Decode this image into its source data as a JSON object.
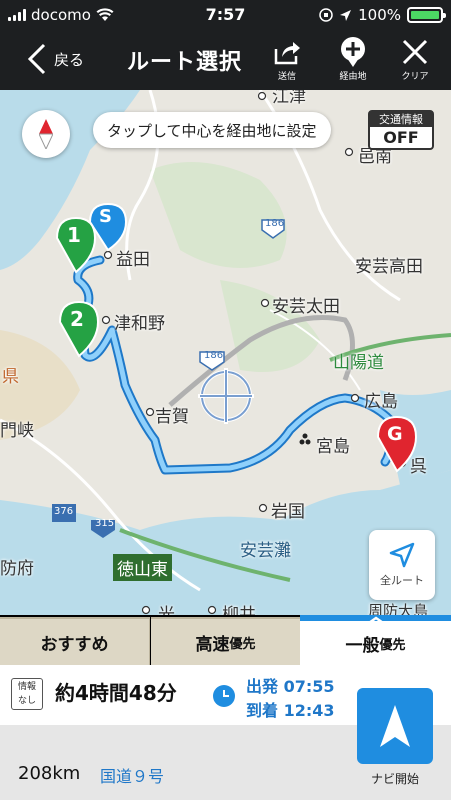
{
  "status": {
    "carrier": "docomo",
    "time": "7:57",
    "battery": "100%",
    "battery_level": 1.0
  },
  "nav": {
    "back_label": "戻る",
    "title": "ルート選択",
    "send_label": "送信",
    "waypoint_label": "経由地",
    "clear_label": "クリア"
  },
  "map": {
    "tip_text": "タップして中心を経由地に設定",
    "traffic_title": "交通情報",
    "traffic_state": "OFF",
    "all_route_label": "全ルート",
    "places": {
      "gotsu": "江津",
      "hikawa": "邑南",
      "masuda": "益田",
      "aki_takata": "安芸高田",
      "tsuwano": "津和野",
      "aki_ota": "安芸太田",
      "sanyo": "山陽道",
      "hiroshima": "広島",
      "yoshika": "吉賀",
      "miyajima": "宮島",
      "kure": "呉",
      "iwakuni": "岩国",
      "aki_nada": "安芸灘",
      "tokuyama": "徳山東",
      "hofu": "防府",
      "mon": "門峡",
      "ken": "県",
      "hikari": "光",
      "yanai": "柳井",
      "suo": "周防大島"
    },
    "road_numbers": {
      "r186a": "186",
      "r186b": "186",
      "r376": "376",
      "r315": "315"
    },
    "markers": {
      "start": "S",
      "wp1": "1",
      "wp2": "2",
      "goal": "G"
    },
    "colors": {
      "route": "#5ab4f0",
      "route_outline": "#1e78c8",
      "sea": "#b9dcea",
      "land": "#e9e7e0",
      "forest": "#cfe0c3"
    }
  },
  "tabs": [
    {
      "label": "おすすめ",
      "active": false
    },
    {
      "label": "高速",
      "suffix": "優先",
      "active": false
    },
    {
      "label": "一般",
      "suffix": "優先",
      "active": true
    }
  ],
  "info": {
    "badge_line1": "情報",
    "badge_line2": "なし",
    "duration": "約4時間48分",
    "depart_label": "出発",
    "depart_time": "07:55",
    "arrive_label": "到着",
    "arrive_time": "12:43"
  },
  "summary": {
    "distance": "208km",
    "route": "国道９号",
    "navi_label": "ナビ開始"
  }
}
